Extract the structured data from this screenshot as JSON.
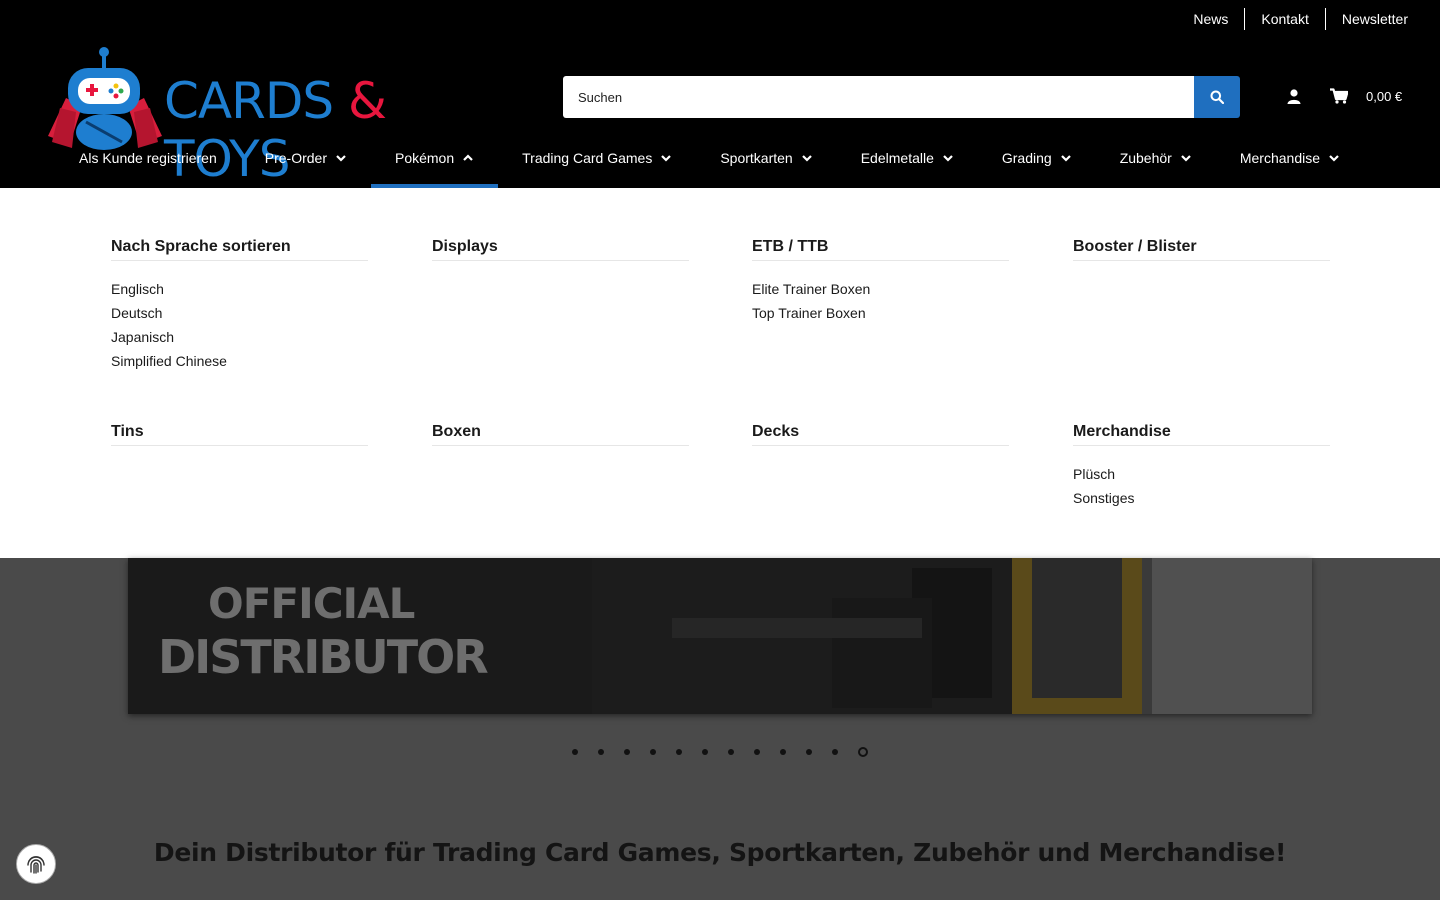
{
  "topbar": {
    "links": [
      "News",
      "Kontakt",
      "Newsletter"
    ]
  },
  "logo": {
    "word1": "CARDS",
    "amp": "&",
    "word2": "TOYS"
  },
  "search": {
    "placeholder": "Suchen",
    "icon": "search-icon"
  },
  "cart": {
    "total": "0,00 €",
    "icon": "cart-icon"
  },
  "account": {
    "icon": "user-icon"
  },
  "nav": {
    "items": [
      {
        "label": "Als Kunde registrieren",
        "has_chevron": false
      },
      {
        "label": "Pre-Order",
        "has_chevron": true
      },
      {
        "label": "Pokémon",
        "has_chevron": true,
        "active": true
      },
      {
        "label": "Trading Card Games",
        "has_chevron": true
      },
      {
        "label": "Sportkarten",
        "has_chevron": true
      },
      {
        "label": "Edelmetalle",
        "has_chevron": true
      },
      {
        "label": "Grading",
        "has_chevron": true
      },
      {
        "label": "Zubehör",
        "has_chevron": true
      },
      {
        "label": "Merchandise",
        "has_chevron": true
      }
    ]
  },
  "mega": {
    "columns": [
      {
        "title": "Nach Sprache sortieren",
        "items": [
          "Englisch",
          "Deutsch",
          "Japanisch",
          "Simplified Chinese"
        ]
      },
      {
        "title": "Displays",
        "items": []
      },
      {
        "title": "ETB / TTB",
        "items": [
          "Elite Trainer Boxen",
          "Top Trainer Boxen"
        ]
      },
      {
        "title": "Booster / Blister",
        "items": []
      },
      {
        "title": "Tins",
        "items": []
      },
      {
        "title": "Boxen",
        "items": []
      },
      {
        "title": "Decks",
        "items": []
      },
      {
        "title": "Merchandise",
        "items": [
          "Plüsch",
          "Sonstiges"
        ]
      }
    ]
  },
  "hero": {
    "line1": "OFFICIAL",
    "line2": "DISTRIBUTOR"
  },
  "slider": {
    "count": 12,
    "active": 12
  },
  "tagline": "Dein Distributor für Trading Card Games, Sportkarten, Zubehör und Merchandise!",
  "colors": {
    "accent": "#1f6fbf",
    "logo_blue": "#1e7ed0",
    "logo_red": "#e8163e"
  }
}
